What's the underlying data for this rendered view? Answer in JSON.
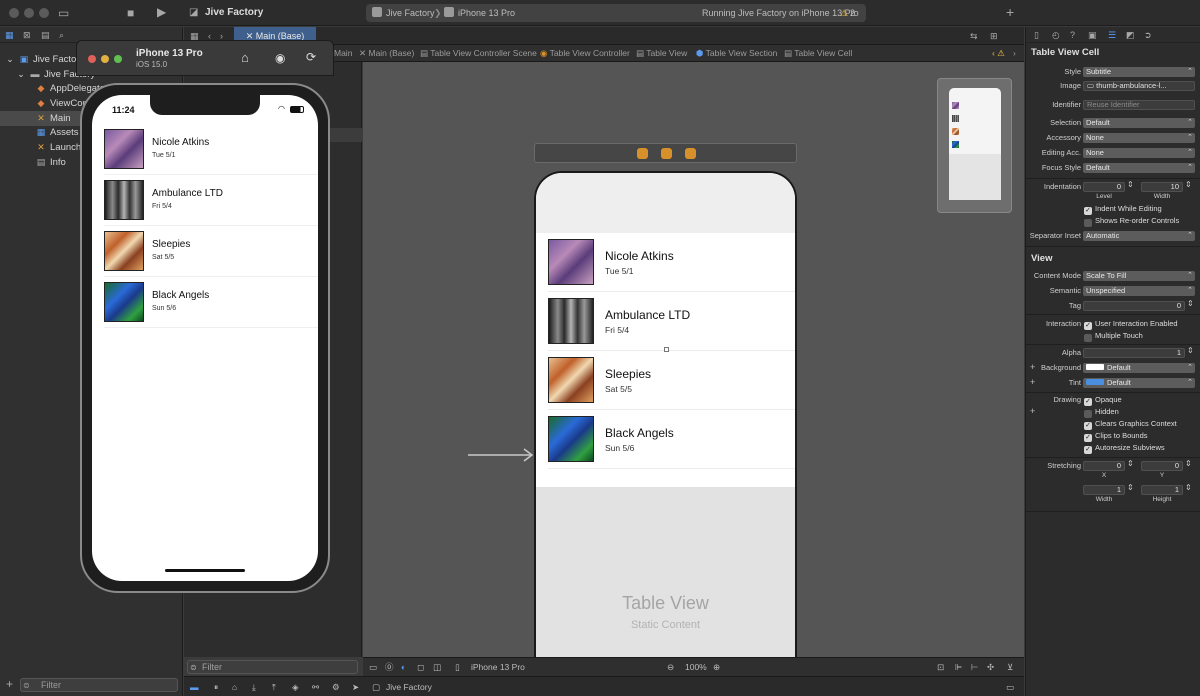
{
  "toolbar": {
    "project_title": "Jive Factory",
    "tab_main": "Main (Base)",
    "scheme": "Jive Factory",
    "device": "iPhone 13 Pro",
    "status": "Running Jive Factory on iPhone 13 Pro",
    "warnings": "2"
  },
  "navigator": {
    "items": [
      {
        "label": "Jive Factory",
        "indent": 0
      },
      {
        "label": "Jive Factory",
        "indent": 1
      },
      {
        "label": "AppDelegate",
        "indent": 2
      },
      {
        "label": "ViewController",
        "indent": 2
      },
      {
        "label": "Main",
        "indent": 2
      },
      {
        "label": "Assets",
        "indent": 2
      },
      {
        "label": "LaunchScreen",
        "indent": 2
      },
      {
        "label": "Info",
        "indent": 2
      }
    ],
    "filter_placeholder": "Filter"
  },
  "simulator": {
    "device_name": "iPhone 13 Pro",
    "os": "iOS 15.0",
    "time": "11:24"
  },
  "jumpbar": [
    "Main",
    "Main (Base)",
    "Table View Controller Scene",
    "Table View Controller",
    "Table View",
    "Table View Section",
    "Table View Cell"
  ],
  "events": [
    {
      "name": "Nicole Atkins",
      "date": "Tue 5/1"
    },
    {
      "name": "Ambulance LTD",
      "date": "Fri 5/4"
    },
    {
      "name": "Sleepies",
      "date": "Sat 5/5"
    },
    {
      "name": "Black Angels",
      "date": "Sun 5/6"
    }
  ],
  "canvas": {
    "static_title": "Table View",
    "static_subtitle": "Static Content",
    "zoom": "100%",
    "device_label": "iPhone 13 Pro"
  },
  "outline": {
    "filter_placeholder": "Filter"
  },
  "debugbar": {
    "target": "Jive Factory"
  },
  "inspector": {
    "cell_section": "Table View Cell",
    "style_label": "Style",
    "style_value": "Subtitle",
    "image_label": "Image",
    "image_value": "thumb-ambulance-l...",
    "identifier_label": "Identifier",
    "identifier_placeholder": "Reuse Identifier",
    "selection_label": "Selection",
    "selection_value": "Default",
    "accessory_label": "Accessory",
    "accessory_value": "None",
    "editing_label": "Editing Acc.",
    "editing_value": "None",
    "focus_label": "Focus Style",
    "focus_value": "Default",
    "indentation_label": "Indentation",
    "level_value": "0",
    "width_value": "10",
    "level_caption": "Level",
    "width_caption": "Width",
    "indent_while_editing": "Indent While Editing",
    "show_reorder": "Shows Re-order Controls",
    "separator_label": "Separator Inset",
    "separator_value": "Automatic",
    "view_section": "View",
    "content_mode_label": "Content Mode",
    "content_mode_value": "Scale To Fill",
    "semantic_label": "Semantic",
    "semantic_value": "Unspecified",
    "tag_label": "Tag",
    "tag_value": "0",
    "interaction_label": "Interaction",
    "user_interaction": "User Interaction Enabled",
    "multiple_touch": "Multiple Touch",
    "alpha_label": "Alpha",
    "alpha_value": "1",
    "background_label": "Background",
    "background_value": "Default",
    "tint_label": "Tint",
    "tint_value": "Default",
    "drawing_label": "Drawing",
    "opaque": "Opaque",
    "hidden": "Hidden",
    "clears_graphics": "Clears Graphics Context",
    "clips_bounds": "Clips to Bounds",
    "autoresize": "Autoresize Subviews",
    "stretching_label": "Stretching",
    "stretch_x": "0",
    "stretch_y": "0",
    "stretch_w": "1",
    "stretch_h": "1",
    "x_caption": "X",
    "y_caption": "Y",
    "w_caption": "Width",
    "h_caption": "Height"
  },
  "colors": {
    "accent": "#3f5f8c",
    "tint_swatch": "#4a8fe0",
    "storyboard_icon": "#d8902a"
  }
}
